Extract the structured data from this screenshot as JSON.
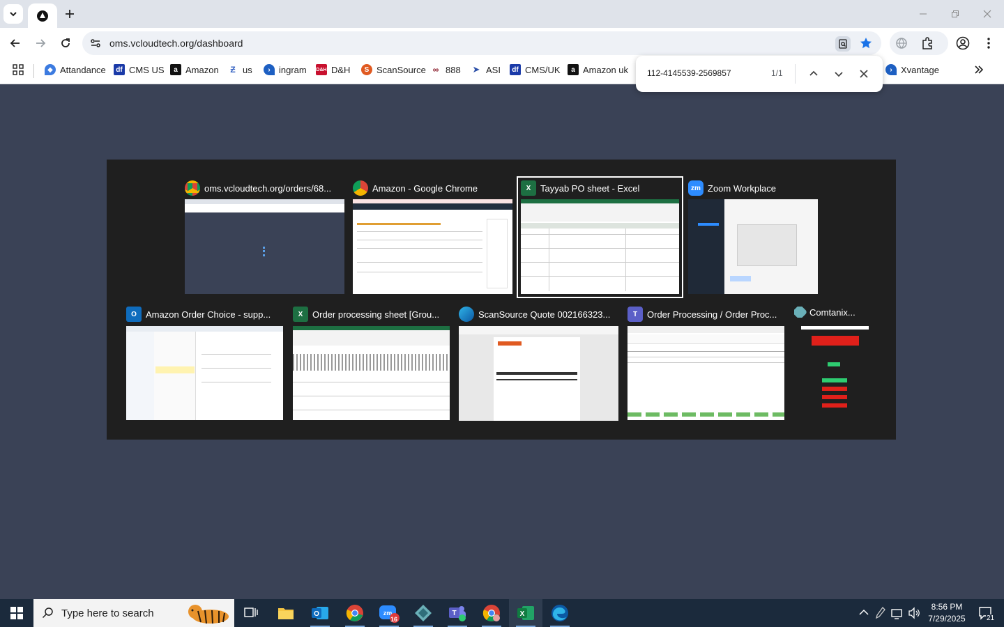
{
  "browser": {
    "url": "oms.vcloudtech.org/dashboard",
    "bookmarks": [
      {
        "label": "Attandance",
        "icon": "attendance-icon",
        "color": "#3c7be0"
      },
      {
        "label": "CMS US",
        "icon": "cms-icon",
        "color": "#1a3aa8"
      },
      {
        "label": "Amazon",
        "icon": "amazon-icon",
        "color": "#111111"
      },
      {
        "label": "us",
        "icon": "us-icon",
        "color": "#3a66c4"
      },
      {
        "label": "ingram",
        "icon": "ingram-icon",
        "color": "#1d5fc2"
      },
      {
        "label": "D&H",
        "icon": "dh-icon",
        "color": "#c8102e"
      },
      {
        "label": "ScanSource",
        "icon": "scansource-icon",
        "color": "#e05a21"
      },
      {
        "label": "888",
        "icon": "888-icon",
        "color": "#8a1c2b"
      },
      {
        "label": "ASI",
        "icon": "asi-icon",
        "color": "#2b4fa8"
      },
      {
        "label": "CMS/UK",
        "icon": "cms-uk-icon",
        "color": "#1a3aa8"
      },
      {
        "label": "Amazon uk",
        "icon": "amazon-uk-icon",
        "color": "#111111"
      },
      {
        "label": "Xvantage",
        "icon": "xvantage-icon",
        "color": "#1d5fc2"
      }
    ]
  },
  "findbar": {
    "query": "112-4145539-2569857",
    "count": "1/1"
  },
  "switcher": {
    "windows": [
      {
        "title": "oms.vcloudtech.org/orders/68...",
        "app": "chrome"
      },
      {
        "title": "Amazon - Google Chrome",
        "app": "chrome"
      },
      {
        "title": "Tayyab PO sheet - Excel",
        "app": "excel"
      },
      {
        "title": "Zoom Workplace",
        "app": "zoom"
      },
      {
        "title": "Amazon Order Choice - supp...",
        "app": "outlook"
      },
      {
        "title": "Order processing sheet  [Grou...",
        "app": "excel"
      },
      {
        "title": "ScanSource Quote 002166323...",
        "app": "edge"
      },
      {
        "title": "Order Processing / Order Proc...",
        "app": "teams"
      },
      {
        "title": "Comtanix...",
        "app": "comtanix"
      }
    ]
  },
  "taskbar": {
    "search_placeholder": "Type here to search",
    "zoom_badge": "16",
    "time": "8:56 PM",
    "date": "7/29/2025",
    "notifications": "21"
  },
  "colors": {
    "accent": "#1a73e8",
    "switcher_bg": "#1f1f1f",
    "desktop_bg": "#3a4256",
    "taskbar_bg": "#1b2a3c"
  }
}
